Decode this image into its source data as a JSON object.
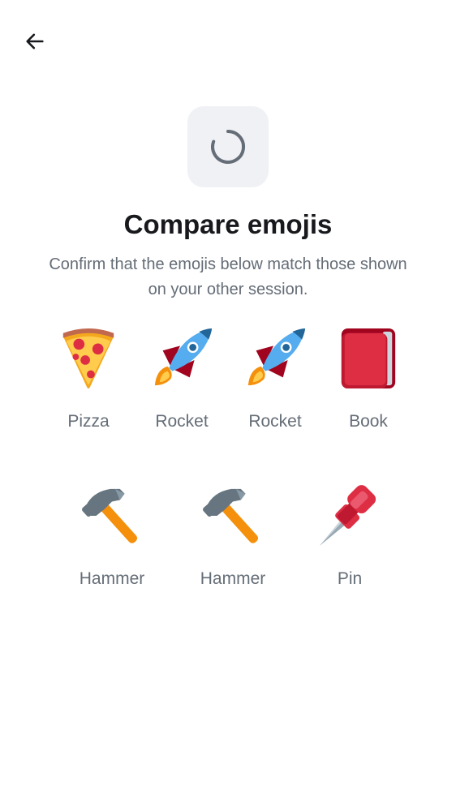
{
  "header": {
    "back_icon": "arrow-left-icon"
  },
  "status": {
    "icon": "spinner-icon"
  },
  "title": "Compare emojis",
  "description": "Confirm that the emojis below match those shown on your other session.",
  "emojis_row1": [
    {
      "icon": "pizza-icon",
      "label": "Pizza"
    },
    {
      "icon": "rocket-icon",
      "label": "Rocket"
    },
    {
      "icon": "rocket-icon",
      "label": "Rocket"
    },
    {
      "icon": "book-icon",
      "label": "Book"
    }
  ],
  "emojis_row2": [
    {
      "icon": "hammer-icon",
      "label": "Hammer"
    },
    {
      "icon": "hammer-icon",
      "label": "Hammer"
    },
    {
      "icon": "pin-icon",
      "label": "Pin"
    }
  ],
  "colors": {
    "title": "#17191c",
    "secondary_text": "#656d77",
    "tile_background": "#eff1f5",
    "spinner": "#656d77"
  }
}
